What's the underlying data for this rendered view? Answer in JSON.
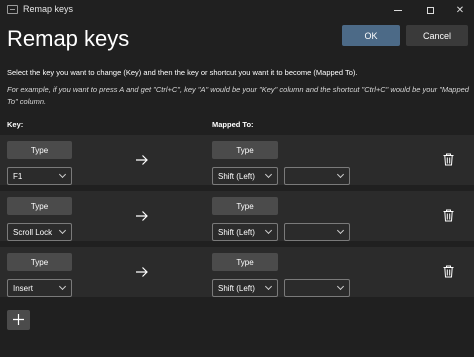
{
  "window": {
    "title": "Remap keys",
    "close_glyph": "✕"
  },
  "header": {
    "title": "Remap keys",
    "ok_label": "OK",
    "cancel_label": "Cancel"
  },
  "instructions": {
    "main": "Select the key you want to change (Key) and then the key or shortcut you want it to become (Mapped To).",
    "example": "For example, if you want to press A and get \"Ctrl+C\", key \"A\" would be your \"Key\" column and the shortcut \"Ctrl+C\" would be your \"Mapped To\" column."
  },
  "columns": {
    "key": "Key:",
    "mapped_to": "Mapped To:"
  },
  "rows": [
    {
      "type_label": "Type",
      "key": "F1",
      "mapped_type_label": "Type",
      "mapped_key": "Shift (Left)",
      "mapped_key2": ""
    },
    {
      "type_label": "Type",
      "key": "Scroll Lock",
      "mapped_type_label": "Type",
      "mapped_key": "Shift (Left)",
      "mapped_key2": ""
    },
    {
      "type_label": "Type",
      "key": "Insert",
      "mapped_type_label": "Type",
      "mapped_key": "Shift (Left)",
      "mapped_key2": ""
    }
  ],
  "icons": {
    "arrow": "arrow-right-icon",
    "delete": "trash-icon",
    "add": "plus-icon"
  },
  "colors": {
    "background": "#202020",
    "row_background": "#2b2b2b",
    "accent_ok": "#4c6a87",
    "button": "#4b4b4b"
  }
}
